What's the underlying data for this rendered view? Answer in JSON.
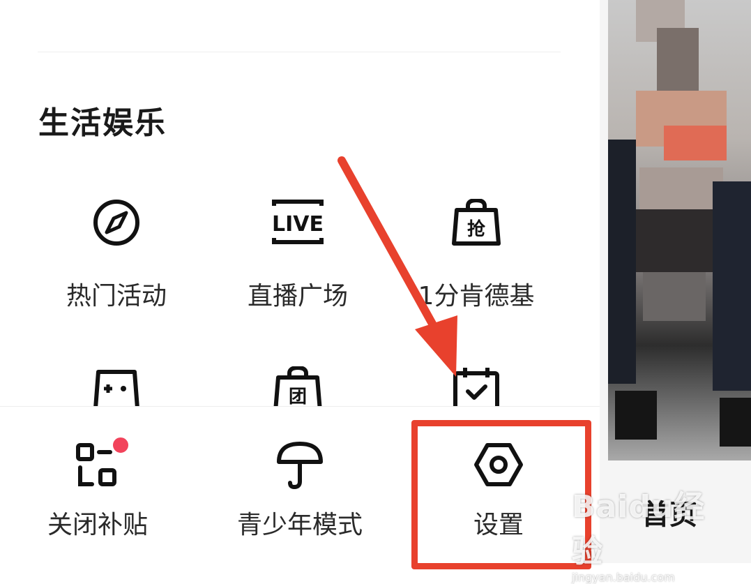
{
  "section": {
    "title": "生活娱乐"
  },
  "grid_items": [
    {
      "label": "热门活动",
      "icon": "compass-icon"
    },
    {
      "label": "直播广场",
      "icon": "live-icon"
    },
    {
      "label": "1分肯德基",
      "icon": "grab-bag-icon"
    },
    {
      "label": "",
      "icon": "game-controller-icon"
    },
    {
      "label": "",
      "icon": "group-bag-icon"
    },
    {
      "label": "",
      "icon": "calendar-check-icon"
    }
  ],
  "live_icon_text": "LIVE",
  "grab_icon_text": "抢",
  "group_icon_text": "团",
  "bottom_bar": {
    "items": [
      {
        "label": "关闭补贴",
        "icon": "qr-scan-icon",
        "has_badge": true
      },
      {
        "label": "青少年模式",
        "icon": "umbrella-icon"
      },
      {
        "label": "设置",
        "icon": "settings-hexagon-icon"
      }
    ]
  },
  "right_panel": {
    "home_label": "首页"
  },
  "watermark": {
    "main": "Baidu经验",
    "sub": "jingyan.baidu.com"
  },
  "colors": {
    "accent_red": "#e8412d",
    "badge_red": "#f2435b",
    "text": "#1a1a1a"
  }
}
